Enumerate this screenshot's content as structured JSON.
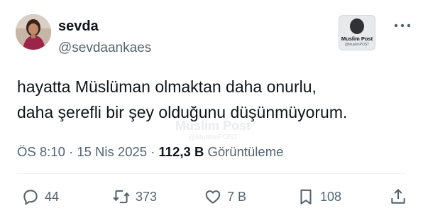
{
  "author": {
    "name": "sevda",
    "handle": "@sevdaankaes"
  },
  "badge": {
    "title": "Muslim Post",
    "subtitle": "@MuslimPOST"
  },
  "tweet": {
    "lines": [
      "hayatta Müslüman olmaktan daha onurlu,",
      "daha şerefli bir şey olduğunu düşünmüyorum."
    ]
  },
  "watermark": {
    "title": "Muslim Post",
    "subtitle": "@MuslimPOST"
  },
  "meta": {
    "time": "ÖS 8:10",
    "date": "15 Nis 2025",
    "separator": "·",
    "views": "112,3 B",
    "views_label": "Görüntüleme"
  },
  "actions": {
    "replies": "44",
    "reposts": "373",
    "likes": "7 B",
    "bookmarks": "108"
  },
  "colors": {
    "text": "#0f1419",
    "secondary": "#536471",
    "divider": "#eff3f4"
  },
  "icons": [
    "more-icon",
    "reply-icon",
    "repost-icon",
    "like-icon",
    "bookmark-icon",
    "share-icon"
  ]
}
